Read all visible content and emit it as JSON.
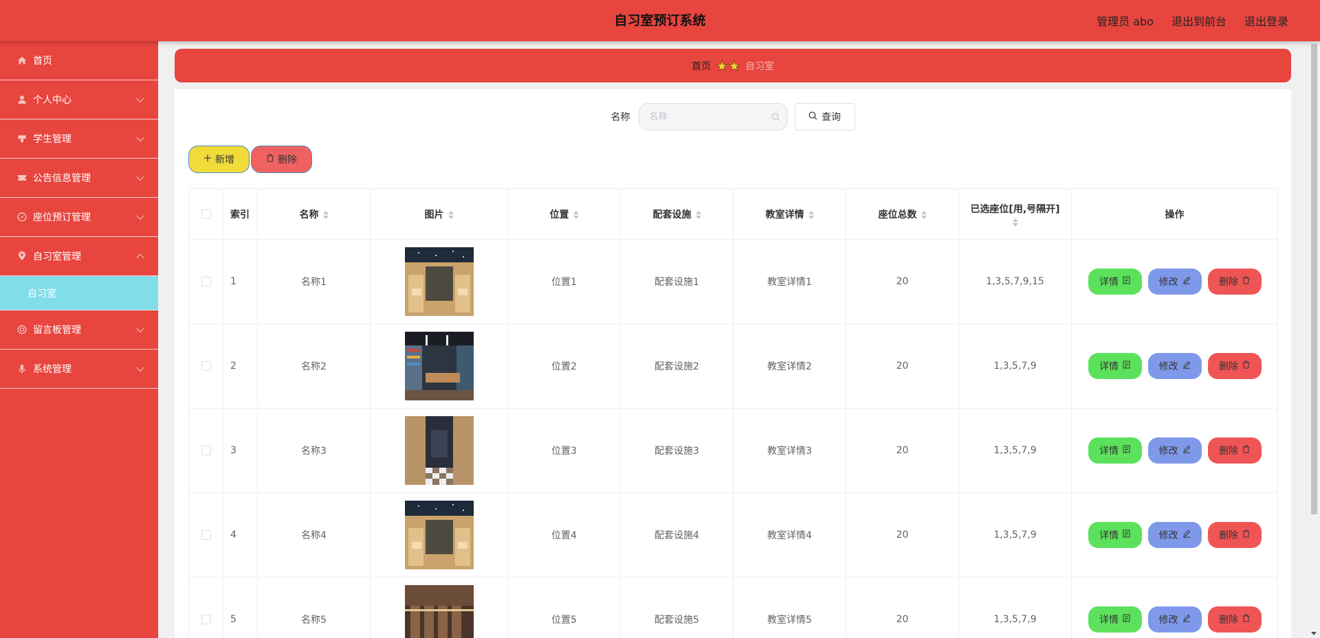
{
  "header": {
    "title": "自习室预订系统",
    "user": "管理员 abo",
    "to_front": "退出到前台",
    "logout": "退出登录"
  },
  "sidebar": {
    "items": [
      {
        "label": "首页",
        "icon": "home-icon"
      },
      {
        "label": "个人中心",
        "icon": "user-icon"
      },
      {
        "label": "学生管理",
        "icon": "student-icon"
      },
      {
        "label": "公告信息管理",
        "icon": "ticket-icon"
      },
      {
        "label": "座位预订管理",
        "icon": "compass-icon"
      },
      {
        "label": "自习室管理",
        "icon": "location-icon"
      },
      {
        "label": "留言板管理",
        "icon": "lifebuoy-icon"
      },
      {
        "label": "系统管理",
        "icon": "microphone-icon"
      }
    ],
    "active_sub": "自习室"
  },
  "breadcrumb": {
    "home": "首页",
    "current": "自习室"
  },
  "search": {
    "label": "名称",
    "placeholder": "名称",
    "query_label": "查询"
  },
  "actions": {
    "add_label": "新增",
    "delete_label": "删除"
  },
  "table": {
    "headers": {
      "index": "索引",
      "name": "名称",
      "image": "图片",
      "location": "位置",
      "facilities": "配套设施",
      "detail": "教室详情",
      "seats": "座位总数",
      "selected": "已选座位[用,号隔开]",
      "ops": "操作"
    },
    "rows": [
      {
        "index": "1",
        "name": "名称1",
        "location": "位置1",
        "facilities": "配套设施1",
        "detail": "教室详情1",
        "seats": "20",
        "selected": "1,3,5,7,9,15"
      },
      {
        "index": "2",
        "name": "名称2",
        "location": "位置2",
        "facilities": "配套设施2",
        "detail": "教室详情2",
        "seats": "20",
        "selected": "1,3,5,7,9"
      },
      {
        "index": "3",
        "name": "名称3",
        "location": "位置3",
        "facilities": "配套设施3",
        "detail": "教室详情3",
        "seats": "20",
        "selected": "1,3,5,7,9"
      },
      {
        "index": "4",
        "name": "名称4",
        "location": "位置4",
        "facilities": "配套设施4",
        "detail": "教室详情4",
        "seats": "20",
        "selected": "1,3,5,7,9"
      },
      {
        "index": "5",
        "name": "名称5",
        "location": "位置5",
        "facilities": "配套设施5",
        "detail": "教室详情5",
        "seats": "20",
        "selected": "1,3,5,7,9"
      }
    ],
    "op_labels": {
      "detail": "详情",
      "edit": "修改",
      "delete": "删除"
    }
  },
  "colors": {
    "primary": "#e8453f",
    "active_sub": "#81dde8",
    "add": "#f0db3a",
    "delete": "#f05555",
    "detail": "#5ce15c",
    "edit": "#7f99ea"
  }
}
